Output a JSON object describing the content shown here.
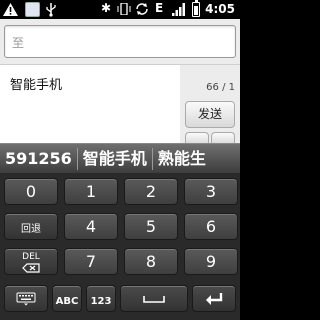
{
  "status_bar": {
    "time": "4:05",
    "network": "E",
    "icons": [
      "warning-icon",
      "app-icon",
      "usb-icon",
      "bluetooth-icon",
      "vibrate-icon",
      "sync-icon",
      "signal-icon",
      "battery-icon"
    ]
  },
  "compose": {
    "recipient_placeholder": "至",
    "message_text": "智能手机",
    "char_count": "66 / 1",
    "send_label": "发送"
  },
  "candidates": [
    "591256",
    "智能手机",
    "熟能生"
  ],
  "keypad": {
    "rows": [
      [
        "",
        "0",
        "1",
        "2"
      ],
      [
        "回退",
        "4",
        "5",
        "6"
      ],
      [
        "DEL",
        "7",
        "8",
        "9"
      ],
      [
        "keyboard",
        "ABC",
        "123",
        "space",
        "enter"
      ]
    ],
    "keys": {
      "k0": "0",
      "k1": "1",
      "k2": "2",
      "back": "回退",
      "k4": "4",
      "k5": "5",
      "k6": "6",
      "del": "DEL",
      "k7": "7",
      "k8": "8",
      "k9": "9",
      "abc": "ABC",
      "num123": "123"
    }
  }
}
